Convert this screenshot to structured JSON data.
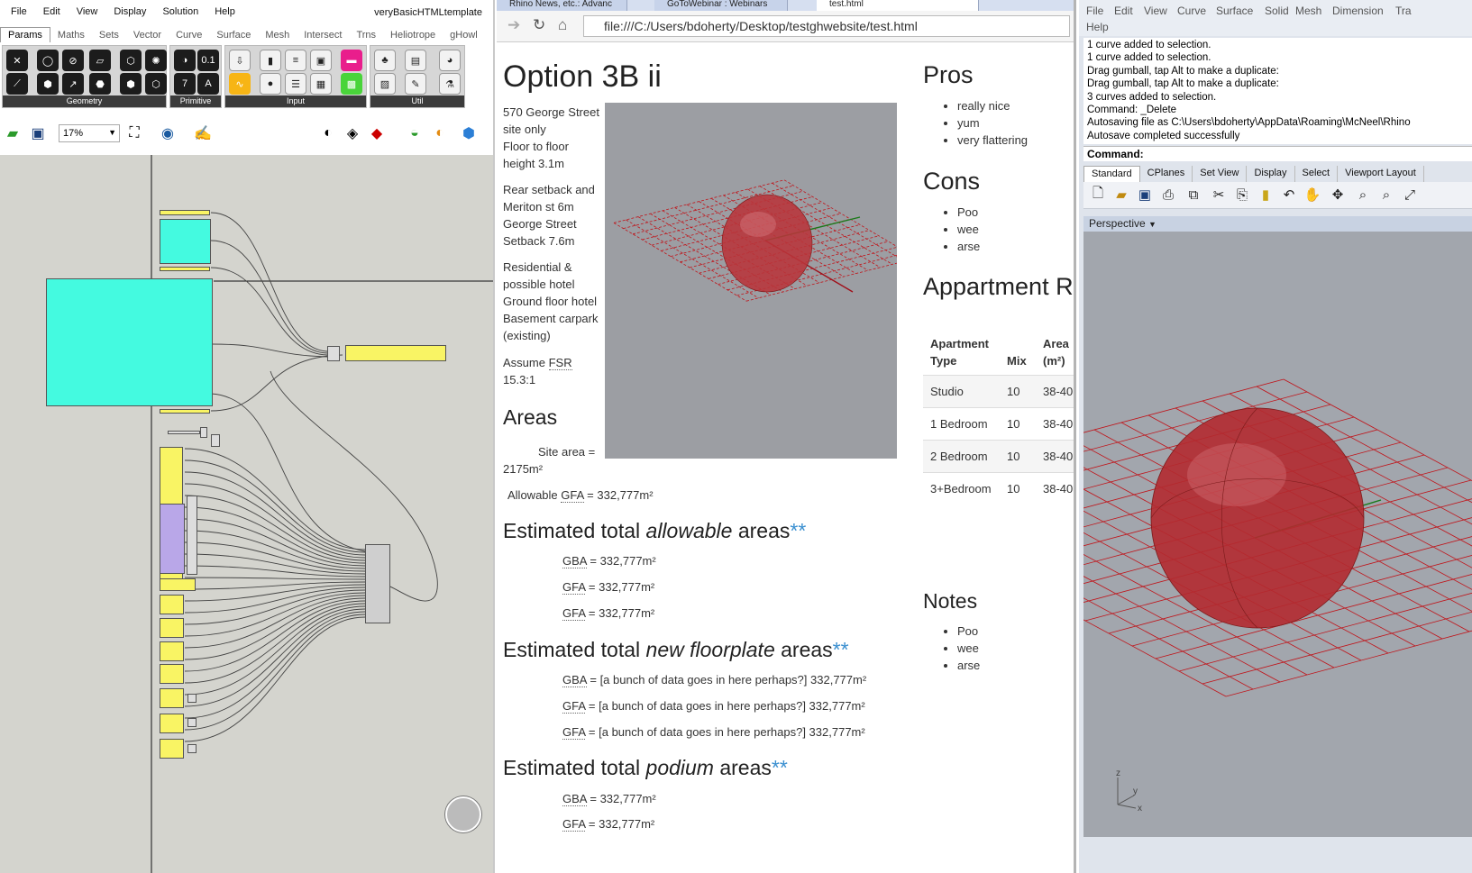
{
  "grasshopper": {
    "menu": [
      "File",
      "Edit",
      "View",
      "Display",
      "Solution",
      "Help"
    ],
    "document_name": "veryBasicHTMLtemplate",
    "tabs": [
      "Params",
      "Maths",
      "Sets",
      "Vector",
      "Curve",
      "Surface",
      "Mesh",
      "Intersect",
      "Trns",
      "Heliotrope",
      "gHowl"
    ],
    "active_tab": "Params",
    "ribbon_groups": [
      "Geometry",
      "Primitive",
      "Input",
      "Util"
    ],
    "zoom": "17%"
  },
  "browser": {
    "tabs": [
      "Rhino News, etc.: Advanc",
      "GoToWebinar : Webinars",
      "test.html"
    ],
    "url": "file:///C:/Users/bdoherty/Desktop/testghwebsite/test.html",
    "page": {
      "title": "Option 3B ii",
      "intro": [
        "570 George Street",
        "site only",
        "Floor to floor",
        "height 3.1m"
      ],
      "setback": [
        "Rear setback and",
        "Meriton st 6m",
        "George Street",
        "Setback 7.6m"
      ],
      "uses": [
        "Residential &",
        "possible hotel",
        "Ground floor hotel",
        "Basement carpark",
        "(existing)"
      ],
      "fsr_prefix": "Assume ",
      "fsr_abbr": "FSR",
      "fsr_value": "15.3:1",
      "areas_heading": "Areas",
      "site_area_line1": "Site area =",
      "site_area_line2": "2175m²",
      "allowable_gfa_prefix": "Allowable ",
      "allowable_gfa_abbr": "GFA",
      "allowable_gfa_value": " = 332,777m²",
      "allowable": {
        "heading_pre": "Estimated total ",
        "heading_em": "allowable",
        "heading_post": " areas",
        "ast": "**",
        "rows": [
          {
            "abbr": "GBA",
            "value": " = 332,777m²"
          },
          {
            "abbr": "GFA",
            "value": " = 332,777m²"
          },
          {
            "abbr": "GFA",
            "value": " = 332,777m²"
          }
        ]
      },
      "new_floorplate": {
        "heading_pre": "Estimated total ",
        "heading_em": "new floorplate",
        "heading_post": " areas",
        "ast": "**",
        "rows": [
          {
            "abbr": "GBA",
            "value": " = [a bunch of data goes in here perhaps?] 332,777m²"
          },
          {
            "abbr": "GFA",
            "value": " = [a bunch of data goes in here perhaps?] 332,777m²"
          },
          {
            "abbr": "GFA",
            "value": " = [a bunch of data goes in here perhaps?] 332,777m²"
          }
        ]
      },
      "podium": {
        "heading_pre": "Estimated total ",
        "heading_em": "podium",
        "heading_post": " areas",
        "ast": "**",
        "rows": [
          {
            "abbr": "GBA",
            "value": " = 332,777m²"
          },
          {
            "abbr": "GFA",
            "value": " = 332,777m²"
          }
        ]
      },
      "pros_heading": "Pros",
      "pros": [
        "really nice",
        "yum",
        "very flattering"
      ],
      "cons_heading": "Cons",
      "cons": [
        "Poo",
        "wee",
        "arse"
      ],
      "apartment_heading": "Appartment R",
      "table": {
        "headers": [
          "Apartment Type",
          "Mix",
          "Area (m²)"
        ],
        "rows": [
          [
            "Studio",
            "10",
            "38-40"
          ],
          [
            "1 Bedroom",
            "10",
            "38-40"
          ],
          [
            "2 Bedroom",
            "10",
            "38-40"
          ],
          [
            "3+Bedroom",
            "10",
            "38-40"
          ]
        ]
      },
      "notes_heading": "Notes",
      "notes": [
        "Poo",
        "wee",
        "arse"
      ]
    }
  },
  "rhino": {
    "menu_row1": [
      "File",
      "Edit",
      "View",
      "Curve",
      "Surface",
      "Solid",
      "Mesh",
      "Dimension",
      "Tra"
    ],
    "menu_row2": [
      "Help"
    ],
    "command_history": [
      "1 curve added to selection.",
      "1 curve added to selection.",
      "Drag gumball, tap Alt to make a duplicate:",
      "Drag gumball, tap Alt to make a duplicate:",
      "3 curves added to selection.",
      "Command: _Delete",
      "Autosaving file as C:\\Users\\bdoherty\\AppData\\Roaming\\McNeel\\Rhino",
      "Autosave completed successfully"
    ],
    "command_prompt": "Command:",
    "toolbar_tabs": [
      "Standard",
      "CPlanes",
      "Set View",
      "Display",
      "Select",
      "Viewport Layout"
    ],
    "viewport_name": "Perspective",
    "axis_labels": [
      "z",
      "y",
      "x"
    ]
  }
}
